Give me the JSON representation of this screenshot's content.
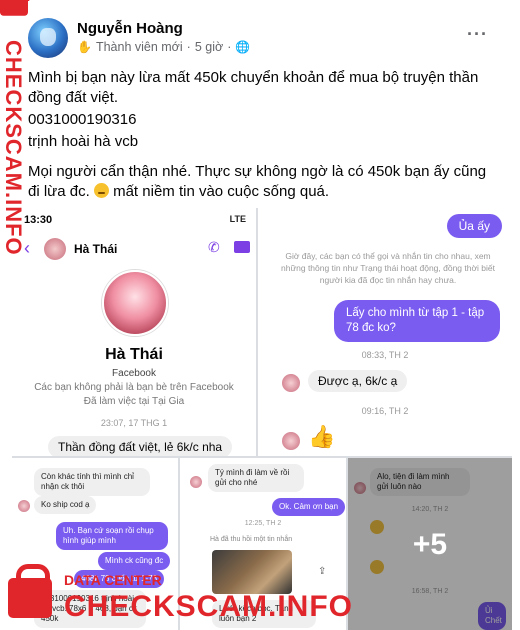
{
  "post": {
    "author": "Nguyễn Hoàng",
    "badge": "Thành viên mới",
    "time": "5 giờ",
    "separator": "·",
    "more": "···",
    "lines": [
      "Mình bị bạn này lừa mất 450k chuyển khoản để mua bộ truyện thần đồng đất việt.",
      "0031000190316",
      "trịnh hoài hà vcb",
      "Mọi người cẩn thận nhé. Thực sự không ngờ là có 450k bạn ấy cũng đi lừa đc.",
      "mất niềm tin vào cuộc sống quá."
    ]
  },
  "photo1": {
    "status_time": "13:30",
    "status_right": "LTE",
    "contact_name": "Hà Thái",
    "profile_name": "Hà Thái",
    "profile_source": "Facebook",
    "info_line1": "Các bạn không phải là bạn bè trên Facebook",
    "info_line2": "Đã làm việc tại Tại Gia",
    "timestamp": "23:07, 17 THG 1",
    "message": "Thần đồng đất việt, lẻ 6k/c nha"
  },
  "photo2": {
    "msg_uay": "Ủa ấy",
    "notice": "Giờ đây, các bạn có thể gọi và nhắn tin cho nhau, xem những thông tin như Trạng thái hoạt động, đồng thời biết người kia đã đọc tin nhắn hay chưa.",
    "msg_ask": "Lấy cho mình từ tập 1 - tập 78 đc ko?",
    "time1": "08:33, TH 2",
    "msg_reply": "Được ạ, 6k/c ạ",
    "time2": "09:16, TH 2"
  },
  "photo3": {
    "m1": "Còn khác tính thì mình chỉ nhận ck thôi",
    "m2": "Ko ship cod ạ",
    "m3": "Uh. Bạn cứ soạn rồi chụp hình giúp mình",
    "m4": "Mình ck cũng đc",
    "m5": "468k 78 cuốn từ 1-78",
    "m6": "0031000190316 trịnh hoài hà vcb. 78x6 = 468, bạn ck 450k"
  },
  "photo4": {
    "m1": "Tý mình đi làm về rồi gửi cho nhé",
    "m2": "Ok. Cảm ơn bạn",
    "time": "12:25, TH 2",
    "m3": "Hà đã thu hồi một tin nhắn",
    "m4": "Lướt kệch bọc. Tặng luôn bạn 2"
  },
  "photo5": {
    "m1": "Alo, tiện đi làm mình gửi luôn nào",
    "time1": "14:20, TH 2",
    "time2": "16:58, TH 2",
    "m2": "Ủi Chết",
    "more_count": "+5"
  },
  "watermark": {
    "vertical": "CHECKSCAM.INFO",
    "data_center": "DATA CENTER",
    "site": "CHECKSCAM.INFO"
  },
  "colors": {
    "messenger_purple": "#7b5cf0",
    "watermark_red": "#e0252b"
  }
}
